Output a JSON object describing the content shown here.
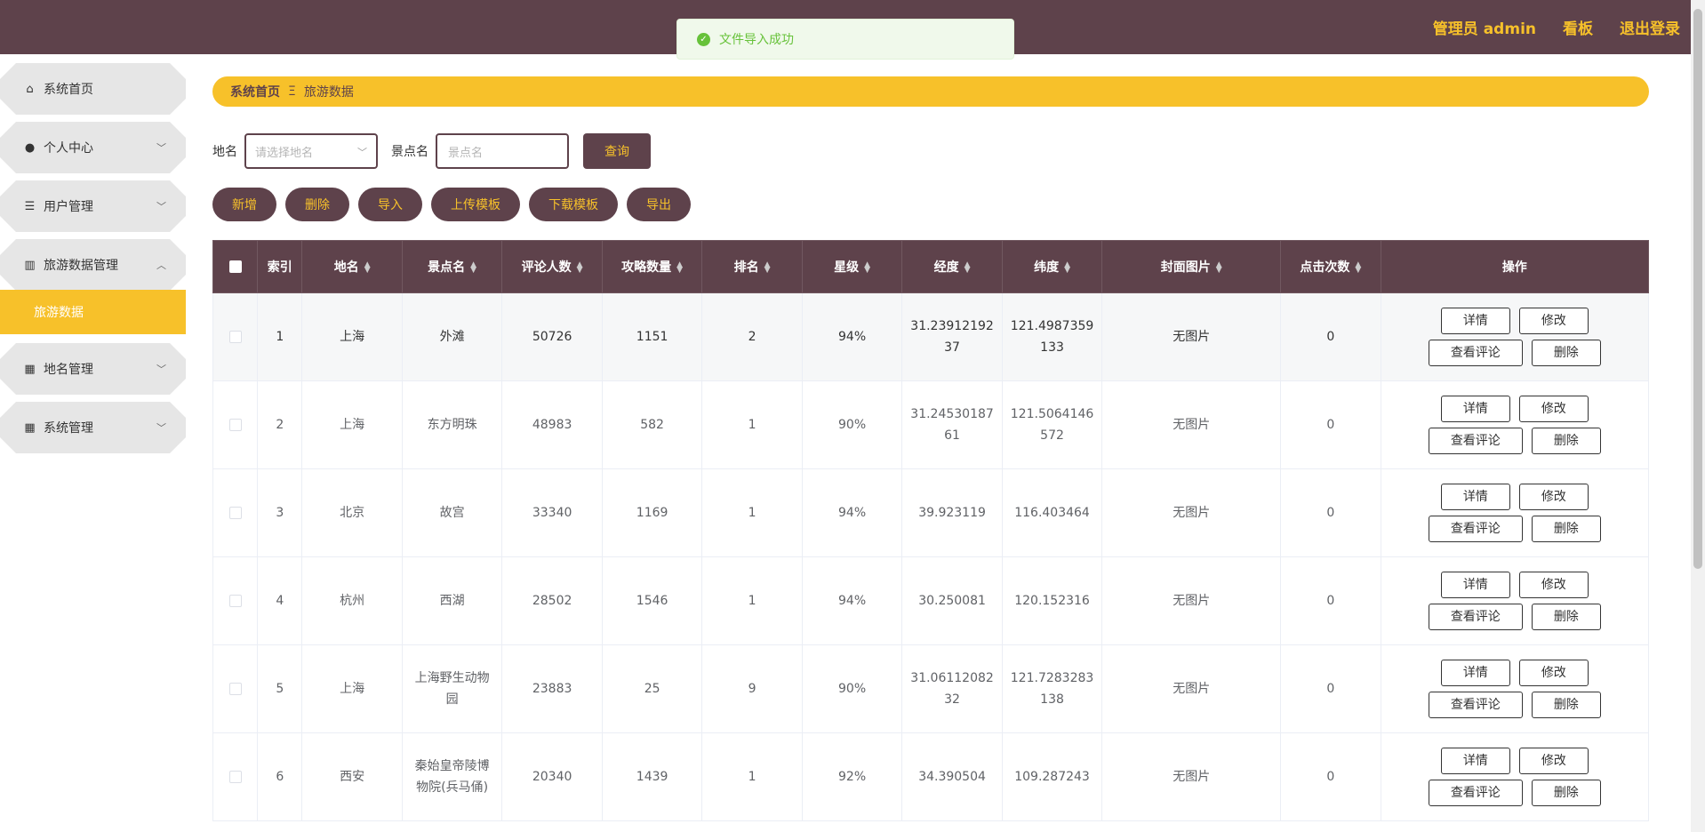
{
  "header": {
    "admin_label": "管理员 admin",
    "dashboard_label": "看板",
    "logout_label": "退出登录"
  },
  "toast": {
    "message": "文件导入成功"
  },
  "sidebar": {
    "items": [
      {
        "label": "系统首页",
        "icon": "home-icon"
      },
      {
        "label": "个人中心",
        "icon": "user-icon"
      },
      {
        "label": "用户管理",
        "icon": "list-icon"
      },
      {
        "label": "旅游数据管理",
        "icon": "library-icon"
      },
      {
        "label": "地名管理",
        "icon": "grid-icon"
      },
      {
        "label": "系统管理",
        "icon": "grid-icon"
      }
    ],
    "active_sub": "旅游数据"
  },
  "breadcrumb": {
    "home": "系统首页",
    "separator": "Ξ",
    "current": "旅游数据"
  },
  "search": {
    "place_label": "地名",
    "place_placeholder": "请选择地名",
    "spot_label": "景点名",
    "spot_placeholder": "景点名",
    "query_label": "查询"
  },
  "actions": {
    "add": "新增",
    "delete": "删除",
    "import": "导入",
    "upload_template": "上传模板",
    "download_template": "下载模板",
    "export": "导出"
  },
  "table": {
    "columns": [
      "索引",
      "地名",
      "景点名",
      "评论人数",
      "攻略数量",
      "排名",
      "星级",
      "经度",
      "纬度",
      "封面图片",
      "点击次数",
      "操作"
    ],
    "rows": [
      {
        "index": "1",
        "place": "上海",
        "spot": "外滩",
        "comments": "50726",
        "guides": "1151",
        "rank": "2",
        "stars": "94%",
        "lng": "31.2391219237",
        "lat": "121.4987359133",
        "cover": "无图片",
        "clicks": "0"
      },
      {
        "index": "2",
        "place": "上海",
        "spot": "东方明珠",
        "comments": "48983",
        "guides": "582",
        "rank": "1",
        "stars": "90%",
        "lng": "31.2453018761",
        "lat": "121.5064146572",
        "cover": "无图片",
        "clicks": "0"
      },
      {
        "index": "3",
        "place": "北京",
        "spot": "故宫",
        "comments": "33340",
        "guides": "1169",
        "rank": "1",
        "stars": "94%",
        "lng": "39.923119",
        "lat": "116.403464",
        "cover": "无图片",
        "clicks": "0"
      },
      {
        "index": "4",
        "place": "杭州",
        "spot": "西湖",
        "comments": "28502",
        "guides": "1546",
        "rank": "1",
        "stars": "94%",
        "lng": "30.250081",
        "lat": "120.152316",
        "cover": "无图片",
        "clicks": "0"
      },
      {
        "index": "5",
        "place": "上海",
        "spot": "上海野生动物园",
        "comments": "23883",
        "guides": "25",
        "rank": "9",
        "stars": "90%",
        "lng": "31.0611208232",
        "lat": "121.7283283138",
        "cover": "无图片",
        "clicks": "0"
      },
      {
        "index": "6",
        "place": "西安",
        "spot": "秦始皇帝陵博物院(兵马俑)",
        "comments": "20340",
        "guides": "1439",
        "rank": "1",
        "stars": "92%",
        "lng": "34.390504",
        "lat": "109.287243",
        "cover": "无图片",
        "clicks": "0"
      }
    ],
    "ops": {
      "detail": "详情",
      "edit": "修改",
      "comments": "查看评论",
      "delete": "删除"
    }
  }
}
